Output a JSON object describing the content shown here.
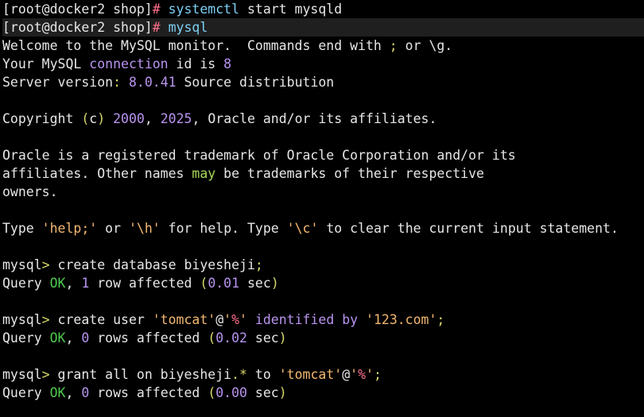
{
  "colors": {
    "default": "#e6e6e6",
    "command": "#7ed0f6",
    "keyword": "#b894ee",
    "number": "#b894ee",
    "string": "#f3b871",
    "ok": "#4ec94e",
    "punct": "#d8d86a",
    "may": "#a6d957",
    "sep": "#ff6f8a",
    "background": "#000000",
    "highlight_background": "#1f1f1f"
  },
  "terminal": {
    "lines": [
      {
        "highlight": false,
        "segments": [
          {
            "text": "[root@docker2 shop]",
            "color": "default"
          },
          {
            "text": "# ",
            "color": "sep"
          },
          {
            "text": "systemctl",
            "color": "command"
          },
          {
            "text": " start mysqld",
            "color": "default"
          }
        ]
      },
      {
        "highlight": true,
        "segments": [
          {
            "text": "[root@docker2 shop]",
            "color": "default"
          },
          {
            "text": "# ",
            "color": "sep"
          },
          {
            "text": "mysql",
            "color": "command"
          }
        ]
      },
      {
        "highlight": false,
        "segments": [
          {
            "text": "Welcome to the MySQL monitor.  Commands end with ",
            "color": "default"
          },
          {
            "text": ";",
            "color": "punct"
          },
          {
            "text": " or \\g.",
            "color": "default"
          }
        ]
      },
      {
        "highlight": false,
        "segments": [
          {
            "text": "Your MySQL ",
            "color": "default"
          },
          {
            "text": "connection",
            "color": "keyword"
          },
          {
            "text": " id is ",
            "color": "default"
          },
          {
            "text": "8",
            "color": "number"
          }
        ]
      },
      {
        "highlight": false,
        "segments": [
          {
            "text": "Server version",
            "color": "default"
          },
          {
            "text": ": ",
            "color": "punct"
          },
          {
            "text": "8.0.41",
            "color": "number"
          },
          {
            "text": " Source distribution",
            "color": "default"
          }
        ]
      },
      {
        "highlight": false,
        "segments": []
      },
      {
        "highlight": false,
        "segments": [
          {
            "text": "Copyright ",
            "color": "default"
          },
          {
            "text": "(",
            "color": "punct"
          },
          {
            "text": "c",
            "color": "default"
          },
          {
            "text": ")",
            "color": "punct"
          },
          {
            "text": " ",
            "color": "default"
          },
          {
            "text": "2000",
            "color": "number"
          },
          {
            "text": ", ",
            "color": "default"
          },
          {
            "text": "2025",
            "color": "number"
          },
          {
            "text": ", Oracle and/or its affiliates.",
            "color": "default"
          }
        ]
      },
      {
        "highlight": false,
        "segments": []
      },
      {
        "highlight": false,
        "segments": [
          {
            "text": "Oracle is a registered trademark of Oracle Corporation and/or its",
            "color": "default"
          }
        ]
      },
      {
        "highlight": false,
        "segments": [
          {
            "text": "affiliates. Other names ",
            "color": "default"
          },
          {
            "text": "may",
            "color": "may"
          },
          {
            "text": " be trademarks of their respective",
            "color": "default"
          }
        ]
      },
      {
        "highlight": false,
        "segments": [
          {
            "text": "owners.",
            "color": "default"
          }
        ]
      },
      {
        "highlight": false,
        "segments": []
      },
      {
        "highlight": false,
        "segments": [
          {
            "text": "Type ",
            "color": "default"
          },
          {
            "text": "'help;'",
            "color": "string"
          },
          {
            "text": " or ",
            "color": "default"
          },
          {
            "text": "'\\h'",
            "color": "string"
          },
          {
            "text": " for help. Type ",
            "color": "default"
          },
          {
            "text": "'\\c'",
            "color": "string"
          },
          {
            "text": " to clear the current input statement.",
            "color": "default"
          }
        ]
      },
      {
        "highlight": false,
        "segments": []
      },
      {
        "highlight": false,
        "segments": [
          {
            "text": "mysql",
            "color": "default"
          },
          {
            "text": ">",
            "color": "punct"
          },
          {
            "text": " create database biyesheji",
            "color": "default"
          },
          {
            "text": ";",
            "color": "punct"
          }
        ]
      },
      {
        "highlight": false,
        "segments": [
          {
            "text": "Query ",
            "color": "default"
          },
          {
            "text": "OK",
            "color": "ok"
          },
          {
            "text": ", ",
            "color": "default"
          },
          {
            "text": "1",
            "color": "number"
          },
          {
            "text": " row affected ",
            "color": "default"
          },
          {
            "text": "(",
            "color": "punct"
          },
          {
            "text": "0.01",
            "color": "number"
          },
          {
            "text": " sec",
            "color": "default"
          },
          {
            "text": ")",
            "color": "punct"
          }
        ]
      },
      {
        "highlight": false,
        "segments": []
      },
      {
        "highlight": false,
        "segments": [
          {
            "text": "mysql",
            "color": "default"
          },
          {
            "text": ">",
            "color": "punct"
          },
          {
            "text": " create user ",
            "color": "default"
          },
          {
            "text": "'tomcat'",
            "color": "string"
          },
          {
            "text": "@",
            "color": "default"
          },
          {
            "text": "'",
            "color": "string"
          },
          {
            "text": "%",
            "color": "sep"
          },
          {
            "text": "'",
            "color": "string"
          },
          {
            "text": " ",
            "color": "default"
          },
          {
            "text": "identified",
            "color": "keyword"
          },
          {
            "text": " ",
            "color": "default"
          },
          {
            "text": "by",
            "color": "keyword"
          },
          {
            "text": " ",
            "color": "default"
          },
          {
            "text": "'123.com'",
            "color": "string"
          },
          {
            "text": ";",
            "color": "punct"
          }
        ]
      },
      {
        "highlight": false,
        "segments": [
          {
            "text": "Query ",
            "color": "default"
          },
          {
            "text": "OK",
            "color": "ok"
          },
          {
            "text": ", ",
            "color": "default"
          },
          {
            "text": "0",
            "color": "number"
          },
          {
            "text": " rows affected ",
            "color": "default"
          },
          {
            "text": "(",
            "color": "punct"
          },
          {
            "text": "0.02",
            "color": "number"
          },
          {
            "text": " sec",
            "color": "default"
          },
          {
            "text": ")",
            "color": "punct"
          }
        ]
      },
      {
        "highlight": false,
        "segments": []
      },
      {
        "highlight": false,
        "segments": [
          {
            "text": "mysql",
            "color": "default"
          },
          {
            "text": ">",
            "color": "punct"
          },
          {
            "text": " grant all on biyesheji",
            "color": "default"
          },
          {
            "text": ".*",
            "color": "punct"
          },
          {
            "text": " to ",
            "color": "default"
          },
          {
            "text": "'tomcat'",
            "color": "string"
          },
          {
            "text": "@",
            "color": "default"
          },
          {
            "text": "'",
            "color": "string"
          },
          {
            "text": "%",
            "color": "sep"
          },
          {
            "text": "'",
            "color": "string"
          },
          {
            "text": ";",
            "color": "punct"
          }
        ]
      },
      {
        "highlight": false,
        "segments": [
          {
            "text": "Query ",
            "color": "default"
          },
          {
            "text": "OK",
            "color": "ok"
          },
          {
            "text": ", ",
            "color": "default"
          },
          {
            "text": "0",
            "color": "number"
          },
          {
            "text": " rows affected ",
            "color": "default"
          },
          {
            "text": "(",
            "color": "punct"
          },
          {
            "text": "0.00",
            "color": "number"
          },
          {
            "text": " sec",
            "color": "default"
          },
          {
            "text": ")",
            "color": "punct"
          }
        ]
      }
    ]
  }
}
